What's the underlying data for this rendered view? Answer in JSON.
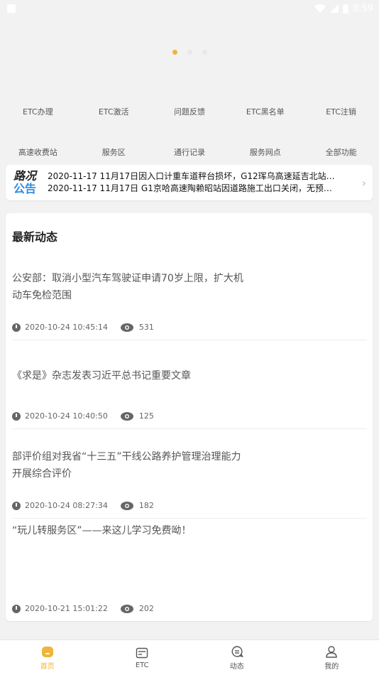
{
  "status_bar": {
    "time": "8:59"
  },
  "carousel": {
    "page_count": 3,
    "active_index": 0
  },
  "grid": {
    "row1": [
      "ETC办理",
      "ETC激活",
      "问题反馈",
      "ETC黑名单",
      "ETC注销"
    ],
    "row2": [
      "高速收费站",
      "服务区",
      "通行记录",
      "服务网点",
      "全部功能"
    ]
  },
  "notice": {
    "logo_top": "路况",
    "logo_bottom": "公告",
    "lines": [
      "2020-11-17  11月17日因入口计重车道秤台损坏，G12珲乌高速延吉北站禁…",
      "2020-11-17  11月17日 G1京哈高速陶赖昭站因道路施工出口关闭，无预计恢…"
    ]
  },
  "news": {
    "title": "最新动态",
    "items": [
      {
        "title": "公安部：取消小型汽车驾驶证申请70岁上限，扩大机动车免检范围",
        "date": "2020-10-24 10:45:14",
        "views": "531"
      },
      {
        "title": "《求是》杂志发表习近平总书记重要文章",
        "date": "2020-10-24 10:40:50",
        "views": "125"
      },
      {
        "title": "部评价组对我省“十三五”干线公路养护管理治理能力开展综合评价",
        "date": "2020-10-24 08:27:34",
        "views": "182"
      },
      {
        "title": "“玩儿转服务区”——来这儿学习免费呦！",
        "date": "2020-10-21 15:01:22",
        "views": "202"
      }
    ]
  },
  "tabbar": {
    "tabs": [
      {
        "label": "首页",
        "icon": "home-icon",
        "active": true
      },
      {
        "label": "ETC",
        "icon": "etc-card-icon",
        "active": false
      },
      {
        "label": "动态",
        "icon": "chat-icon",
        "active": false
      },
      {
        "label": "我的",
        "icon": "user-icon",
        "active": false
      }
    ]
  },
  "colors": {
    "accent": "#f0b43c",
    "notice_blue": "#2f8ae0",
    "background": "#f2f2f2"
  }
}
